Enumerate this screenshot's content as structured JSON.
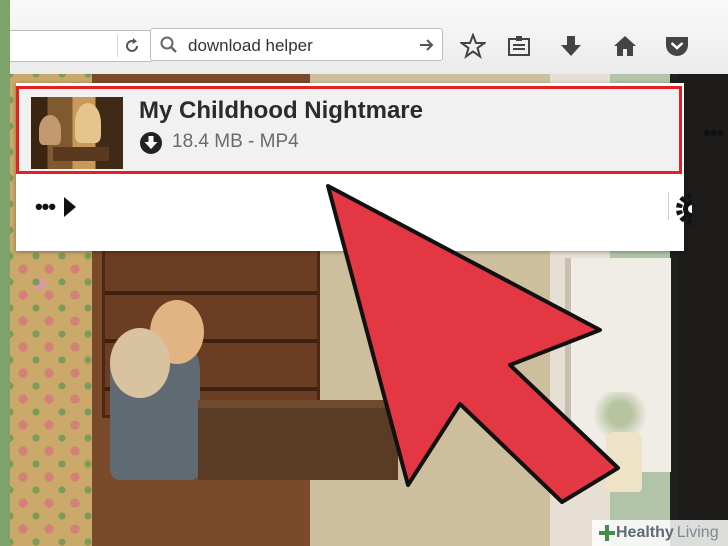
{
  "toolbar": {
    "search_text": "download helper"
  },
  "download_item": {
    "title": "My Childhood Nightmare",
    "meta": "18.4 MB - MP4"
  },
  "panel": {
    "more_label": "•••"
  },
  "watermark": {
    "brand": "Healthy",
    "suffix": "Living"
  },
  "colors": {
    "highlight": "#e41f26",
    "arrow": "#e43744"
  },
  "icons": [
    "reload-icon",
    "search-icon",
    "go-arrow-icon",
    "star-icon",
    "reading-list-icon",
    "download-icon",
    "home-icon",
    "pocket-icon",
    "gear-icon",
    "play-icon"
  ]
}
